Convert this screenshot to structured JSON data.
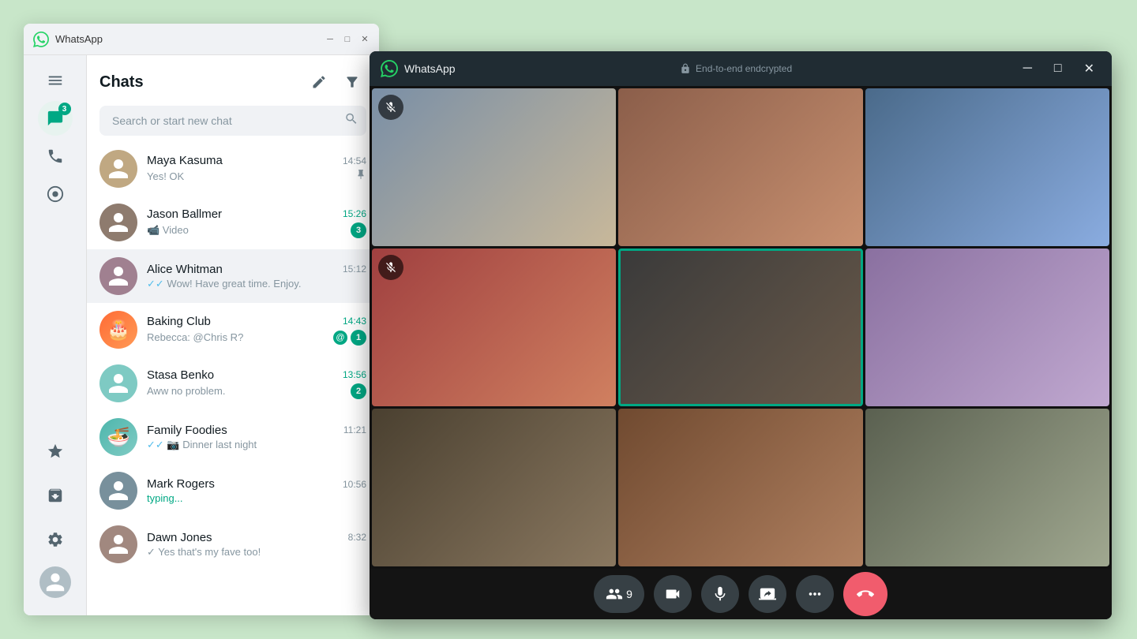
{
  "mainWindow": {
    "title": "WhatsApp",
    "titleBar": {
      "appName": "WhatsApp",
      "minimizeLabel": "─",
      "maximizeLabel": "□",
      "closeLabel": "✕"
    }
  },
  "sidebar": {
    "chatsBadge": "3",
    "icons": {
      "menu": "menu-icon",
      "chats": "chats-icon",
      "calls": "calls-icon",
      "status": "status-icon",
      "starred": "starred-icon",
      "archived": "archived-icon",
      "settings": "settings-icon"
    }
  },
  "chatsPanel": {
    "title": "Chats",
    "editIcon": "edit-icon",
    "filterIcon": "filter-icon",
    "search": {
      "placeholder": "Search or start new chat",
      "searchIcon": "search-icon"
    },
    "chatList": [
      {
        "id": "maya",
        "name": "Maya Kasuma",
        "time": "14:54",
        "timeGreen": false,
        "preview": "Yes! OK",
        "pinned": true,
        "unread": 0,
        "tick": "pin"
      },
      {
        "id": "jason",
        "name": "Jason Ballmer",
        "time": "15:26",
        "timeGreen": true,
        "preview": "📹 Video",
        "unread": 3,
        "tick": "none"
      },
      {
        "id": "alice",
        "name": "Alice Whitman",
        "time": "15:12",
        "timeGreen": false,
        "preview": "✓✓ Wow! Have great time. Enjoy.",
        "unread": 0,
        "active": true
      },
      {
        "id": "baking",
        "name": "Baking Club",
        "time": "14:43",
        "timeGreen": true,
        "preview": "Rebecca: @Chris R?",
        "unread": 1,
        "mention": true
      },
      {
        "id": "stasa",
        "name": "Stasa Benko",
        "time": "13:56",
        "timeGreen": true,
        "preview": "Aww no problem.",
        "unread": 2
      },
      {
        "id": "family",
        "name": "Family Foodies",
        "time": "11:21",
        "timeGreen": false,
        "preview": "✓✓ 📷 Dinner last night",
        "unread": 0
      },
      {
        "id": "mark",
        "name": "Mark Rogers",
        "time": "10:56",
        "timeGreen": false,
        "preview": "typing...",
        "typing": true,
        "unread": 0
      },
      {
        "id": "dawn",
        "name": "Dawn Jones",
        "time": "8:32",
        "timeGreen": false,
        "preview": "✓ Yes that's my fave too!",
        "unread": 0
      }
    ]
  },
  "videoWindow": {
    "title": "WhatsApp",
    "encryptionLabel": "End-to-end endcrypted",
    "minimizeLabel": "─",
    "maximizeLabel": "□",
    "closeLabel": "✕",
    "participants": [
      {
        "id": 1,
        "muted": true,
        "highlighted": false
      },
      {
        "id": 2,
        "muted": false,
        "highlighted": false
      },
      {
        "id": 3,
        "muted": false,
        "highlighted": false
      },
      {
        "id": 4,
        "muted": true,
        "highlighted": false
      },
      {
        "id": 5,
        "muted": false,
        "highlighted": true
      },
      {
        "id": 6,
        "muted": false,
        "highlighted": false
      },
      {
        "id": 7,
        "muted": false,
        "highlighted": false
      },
      {
        "id": 8,
        "muted": false,
        "highlighted": false
      },
      {
        "id": 9,
        "muted": false,
        "highlighted": false
      }
    ],
    "controls": {
      "participantCount": "9",
      "participantsIcon": "participants-icon",
      "videoIcon": "video-icon",
      "micIcon": "mic-icon",
      "screenShareIcon": "screen-share-icon",
      "moreIcon": "more-icon",
      "endCallIcon": "end-call-icon"
    }
  }
}
